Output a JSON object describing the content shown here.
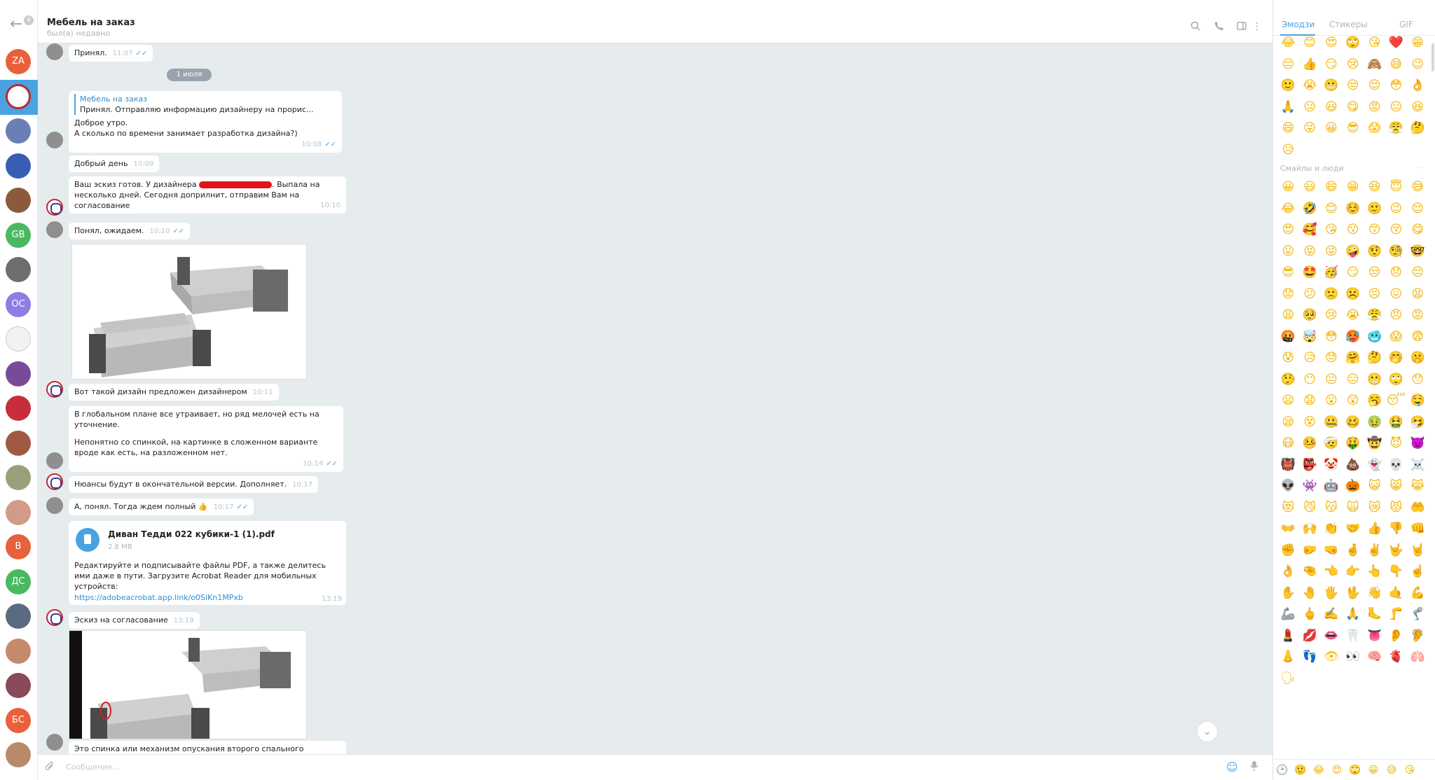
{
  "rail": {
    "unread_badge": "4",
    "avatars": [
      {
        "initials": "ZA",
        "color": "#e8613c"
      },
      {
        "initials": "",
        "color": "#ffffff",
        "logo": true
      },
      {
        "initials": "",
        "color": "#6a7fb5"
      },
      {
        "initials": "",
        "color": "#3a5db4"
      },
      {
        "initials": "",
        "color": "#8c5a3a"
      },
      {
        "initials": "GB",
        "color": "#49b95f"
      },
      {
        "initials": "",
        "color": "#6e6e6e"
      },
      {
        "initials": "OC",
        "color": "#8f7ce6"
      },
      {
        "initials": "",
        "color": "#f2f2f2"
      },
      {
        "initials": "",
        "color": "#7a4a9a"
      },
      {
        "initials": "",
        "color": "#c72d3b"
      },
      {
        "initials": "",
        "color": "#a05a44"
      },
      {
        "initials": "",
        "color": "#9aa07a"
      },
      {
        "initials": "",
        "color": "#d29a88"
      },
      {
        "initials": "В",
        "color": "#e8613c"
      },
      {
        "initials": "ДС",
        "color": "#49b95f"
      },
      {
        "initials": "",
        "color": "#5a6b80"
      },
      {
        "initials": "",
        "color": "#c58a6a"
      },
      {
        "initials": "",
        "color": "#8a4a5a"
      },
      {
        "initials": "БС",
        "color": "#e8613c"
      },
      {
        "initials": "",
        "color": "#b88a6a"
      }
    ]
  },
  "header": {
    "title": "Мебель на заказ",
    "status": "был(а) недавно"
  },
  "chat": {
    "date_pill": "1 июля",
    "messages": {
      "m0": {
        "text": "Принял.",
        "time": "11:07"
      },
      "m1": {
        "reply_name": "Мебель на заказ",
        "reply_text": "Принял. Отправляю информацию дизайнеру на прорис...",
        "line1": "Доброе утро.",
        "line2": "А сколько по времени занимает разработка дизайна?)",
        "time": "10:08"
      },
      "m2": {
        "text": "Добрый день",
        "time": "10:09"
      },
      "m3": {
        "text_a": "Ваш эскиз готов. У дизайнера",
        "text_b": ". Выпала на несколько дней. Сегодня доприлнит, отправим Вам на согласование",
        "time": "10:10"
      },
      "m4": {
        "text": "Понял, ожидаем.",
        "time": "10:10"
      },
      "m5": {
        "text": "Вот такой дизайн предложен дизайнером",
        "time": "10:11"
      },
      "m6": {
        "p1": "В глобальном плане все утраивает, но ряд мелочей есть на уточнение.",
        "p2": "Непонятно со спинкой, на картинке в сложенном варианте вроде как есть, на разложенном нет.",
        "time": "10:14"
      },
      "m7": {
        "text": "Нюансы будут в окончательной версии. Дополняет.",
        "time": "10:17"
      },
      "m8": {
        "text": "А, понял. Тогда ждем полный",
        "emoji": "👍",
        "time": "10:17"
      },
      "m9": {
        "file_name": "Диван Тедди 022 кубики-1 (1).pdf",
        "file_size": "2.8 MB",
        "desc": "Редактируйте и подписывайте файлы PDF, а также делитесь ими даже в пути. Загрузите Acrobat Reader для мобильных устройств:",
        "link": "https://adobeacrobat.app.link/o0SiKn1MPxb",
        "time": "13:19"
      },
      "m10": {
        "text": "Эскиз на согласование",
        "time": "13:19"
      },
      "m11": {
        "text": "Это спинка или механизм опускания второго спального"
      }
    }
  },
  "composer": {
    "placeholder": "Сообщение..."
  },
  "emoji_panel": {
    "tabs": [
      "Эмодзи",
      "Стикеры",
      "GIF"
    ],
    "section_label": "Смайлы и люди",
    "recent": [
      "😂",
      "😊",
      "😍",
      "🙄",
      "😘",
      "❤️",
      "😁",
      "😔",
      "👍",
      "😏",
      "😢",
      "🙈",
      "😅",
      "😉",
      "🙂",
      "😭",
      "😬",
      "😒",
      "😌",
      "😳",
      "👌",
      "🙏",
      "😐",
      "😃",
      "😋",
      "😡",
      "😑",
      "😆",
      "😄",
      "😜",
      "😀",
      "😎",
      "😱",
      "😤",
      "🤔",
      "😥"
    ],
    "people": [
      "😀",
      "😃",
      "😄",
      "😁",
      "😆",
      "😇",
      "😅",
      "😂",
      "🤣",
      "😊",
      "☺️",
      "🙂",
      "😉",
      "😌",
      "😍",
      "🥰",
      "😘",
      "😗",
      "😙",
      "😚",
      "😋",
      "😛",
      "😝",
      "😜",
      "🤪",
      "🤨",
      "🧐",
      "🤓",
      "😎",
      "🤩",
      "🥳",
      "😏",
      "😒",
      "😞",
      "😔",
      "😟",
      "😕",
      "🙁",
      "☹️",
      "😣",
      "😖",
      "😫",
      "😩",
      "🥺",
      "😢",
      "😭",
      "😤",
      "😠",
      "😡",
      "🤬",
      "🤯",
      "😳",
      "🥵",
      "🥶",
      "😱",
      "😨",
      "😰",
      "😥",
      "😓",
      "🤗",
      "🤔",
      "🤭",
      "🤫",
      "🤥",
      "😶",
      "😐",
      "😑",
      "😬",
      "🙄",
      "😯",
      "😦",
      "😧",
      "😮",
      "😲",
      "🥱",
      "😴",
      "🤤",
      "😪",
      "😵",
      "🤐",
      "🥴",
      "🤢",
      "🤮",
      "🤧",
      "😷",
      "🤒",
      "🤕",
      "🤑",
      "🤠",
      "😈",
      "👿",
      "👹",
      "👺",
      "🤡",
      "💩",
      "👻",
      "💀",
      "☠️",
      "👽",
      "👾",
      "🤖",
      "🎃",
      "😺",
      "😸",
      "😹",
      "😻",
      "😼",
      "😽",
      "🙀",
      "😿",
      "😾",
      "🤲",
      "👐",
      "🙌",
      "👏",
      "🤝",
      "👍",
      "👎",
      "👊",
      "✊",
      "🤛",
      "🤜",
      "🤞",
      "✌️",
      "🤟",
      "🤘",
      "👌",
      "🤏",
      "👈",
      "👉",
      "👆",
      "👇",
      "☝️",
      "✋",
      "🤚",
      "🖐",
      "🖖",
      "👋",
      "🤙",
      "💪",
      "🦾",
      "🖕",
      "✍️",
      "🙏",
      "🦶",
      "🦵",
      "🦿",
      "💄",
      "💋",
      "👄",
      "🦷",
      "👅",
      "👂",
      "🦻",
      "👃",
      "👣",
      "👁",
      "👀",
      "🧠",
      "🫀",
      "🫁",
      "🗣"
    ],
    "bottom": [
      "🕑",
      "🙂",
      "😂",
      "😍",
      "🙄",
      "😁",
      "😅",
      "😘",
      "😮",
      "😏",
      "😂"
    ]
  }
}
